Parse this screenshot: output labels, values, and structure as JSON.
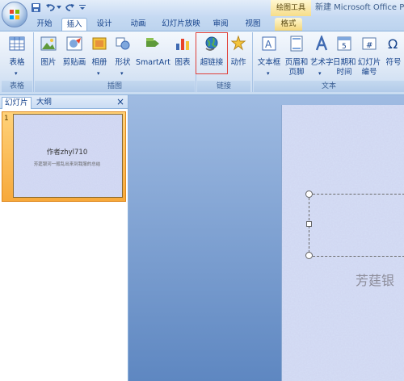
{
  "window": {
    "contextual_tab_group": "绘图工具",
    "title": "新建 Microsoft Office Po"
  },
  "tabs": [
    {
      "label": "开始"
    },
    {
      "label": "插入"
    },
    {
      "label": "设计"
    },
    {
      "label": "动画"
    },
    {
      "label": "幻灯片放映"
    },
    {
      "label": "审阅"
    },
    {
      "label": "视图"
    },
    {
      "label": "格式"
    }
  ],
  "ribbon": {
    "groups": {
      "tables": "表格",
      "illustrations": "插图",
      "links": "链接",
      "text": "文本"
    },
    "buttons": {
      "table": "表格",
      "picture": "图片",
      "clipart": "剪贴画",
      "album": "相册",
      "shapes": "形状",
      "smartart": "SmartArt",
      "chart": "图表",
      "hyperlink": "超链接",
      "action": "动作",
      "textbox_1": "文本框",
      "header_footer_1": "页眉和",
      "header_footer_2": "页脚",
      "wordart_1": "艺术字",
      "datetime_1": "日期和",
      "datetime_2": "时间",
      "slide_number_1": "幻灯片",
      "slide_number_2": "编号",
      "symbol": "符号"
    }
  },
  "left_pane": {
    "tab_slides": "幻灯片",
    "tab_outline": "大纲",
    "close": "×",
    "thumbnail": {
      "number": "1",
      "title": "作者zhyl710",
      "subtitle": "芳莛银河一般乱出来到我服的总结"
    }
  },
  "slide": {
    "subtitle_partial": "芳莛银"
  },
  "colors": {
    "ribbon_text": "#15428b",
    "highlight_border": "#e0413a",
    "selected_thumb": "#f7a93b"
  }
}
